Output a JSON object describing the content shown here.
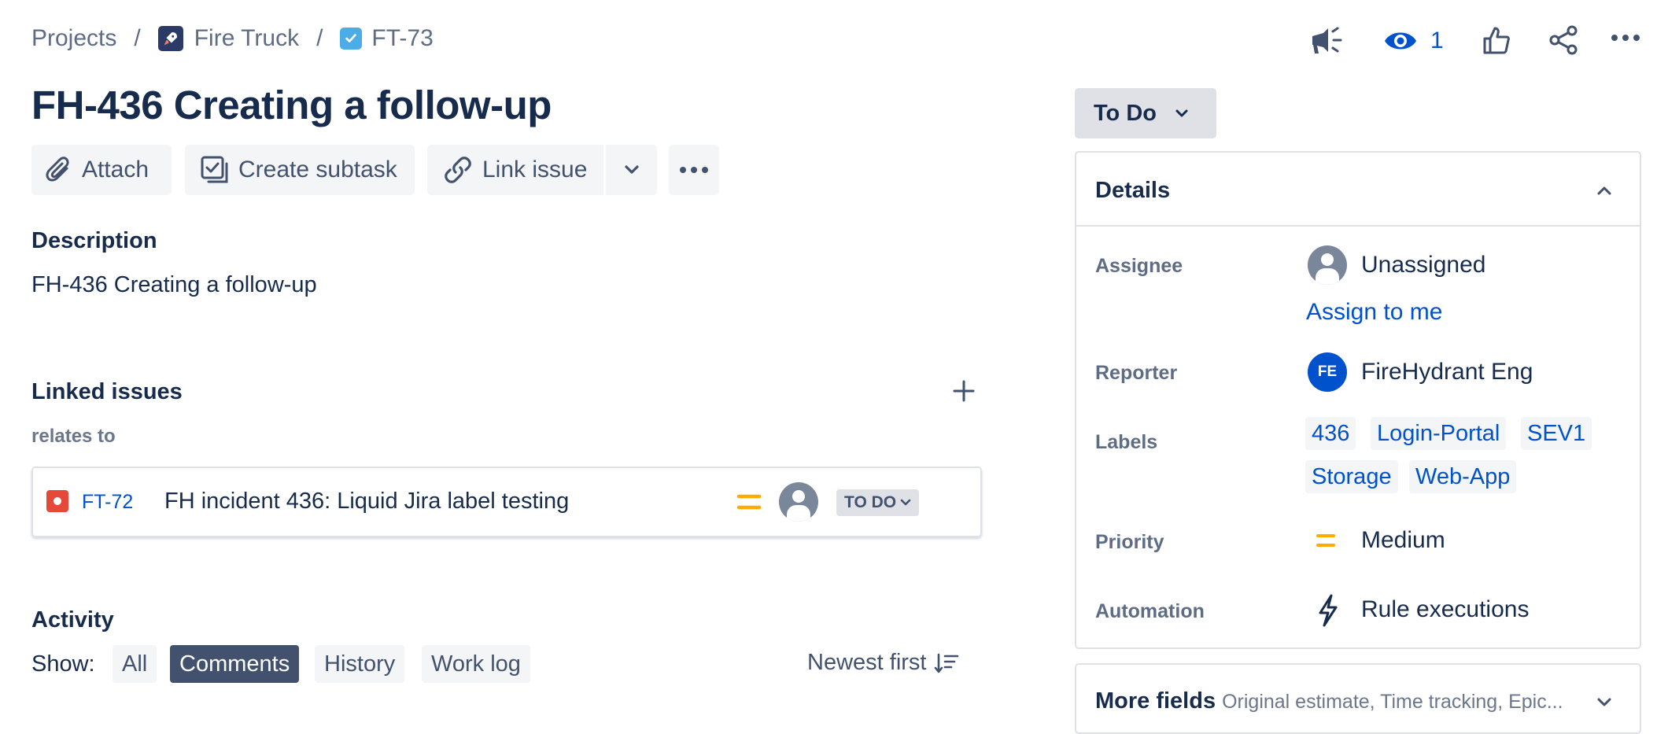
{
  "breadcrumb": {
    "projects": "Projects",
    "separator": "/",
    "project": "Fire Truck",
    "issue_key": "FT-73"
  },
  "header_actions": {
    "watch_count": "1"
  },
  "issue": {
    "title": "FH-436 Creating a follow-up"
  },
  "toolbar": {
    "attach": "Attach",
    "create_subtask": "Create subtask",
    "link_issue": "Link issue"
  },
  "description": {
    "heading": "Description",
    "text": "FH-436 Creating a follow-up"
  },
  "linked_issues": {
    "heading": "Linked issues",
    "relation": "relates to",
    "items": [
      {
        "key": "FT-72",
        "summary": "FH incident 436: Liquid Jira label testing",
        "status": "TO DO"
      }
    ]
  },
  "activity": {
    "heading": "Activity",
    "show_label": "Show:",
    "filters": [
      "All",
      "Comments",
      "History",
      "Work log"
    ],
    "active_filter": "Comments",
    "sort": "Newest first"
  },
  "status": {
    "label": "To Do"
  },
  "details": {
    "heading": "Details",
    "assignee_label": "Assignee",
    "assignee_value": "Unassigned",
    "assign_to_me": "Assign to me",
    "reporter_label": "Reporter",
    "reporter_initials": "FE",
    "reporter_value": "FireHydrant Eng",
    "labels_label": "Labels",
    "labels": [
      "436",
      "Login-Portal",
      "SEV1",
      "Storage",
      "Web-App"
    ],
    "priority_label": "Priority",
    "priority_value": "Medium",
    "automation_label": "Automation",
    "automation_value": "Rule executions"
  },
  "more_fields": {
    "heading": "More fields",
    "summary": "Original estimate, Time tracking, Epic..."
  },
  "colors": {
    "link": "#0052cc",
    "priority_medium": "#ffab00",
    "bug": "#e5493a",
    "reporter_avatar": "#0052cc",
    "active_pill": "#42526e"
  },
  "icons": [
    "rocket-icon",
    "task-checkbox-icon",
    "megaphone-icon",
    "eye-icon",
    "thumbs-up-icon",
    "share-icon",
    "more-icon",
    "paperclip-icon",
    "subtask-icon",
    "link-icon",
    "chevron-down-icon",
    "plus-icon",
    "bug-icon",
    "priority-medium-icon",
    "avatar-icon",
    "sort-icon",
    "lightning-icon",
    "chevron-up-icon"
  ]
}
